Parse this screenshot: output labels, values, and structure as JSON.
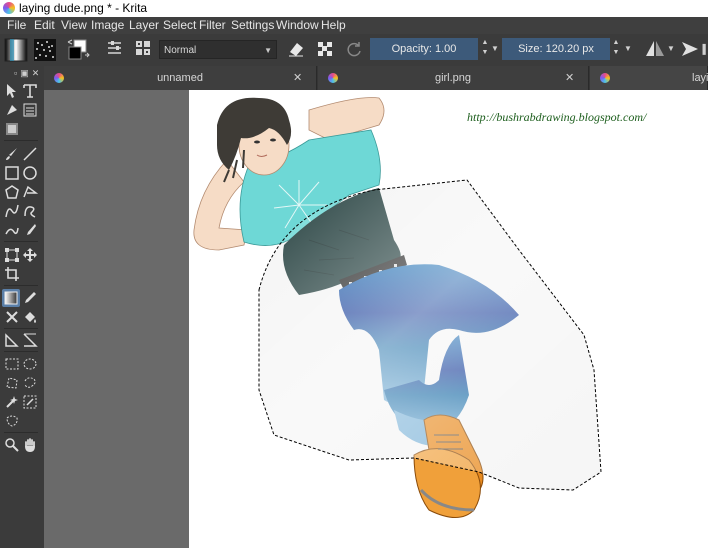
{
  "window": {
    "title": "laying dude.png * - Krita"
  },
  "menu": [
    "File",
    "Edit",
    "View",
    "Image",
    "Layer",
    "Select",
    "Filter",
    "Settings",
    "Window",
    "Help"
  ],
  "toolbar": {
    "blend_mode": "Normal",
    "opacity_label": "Opacity:  1.00",
    "size_label": "Size:  120.20 px"
  },
  "tabs": [
    {
      "name": "unnamed"
    },
    {
      "name": "girl.png"
    },
    {
      "name": "layi"
    }
  ],
  "canvas": {
    "watermark": "http://bushrabdrawing.blogspot.com/"
  },
  "colors": {
    "accent": "#5a7fa8",
    "slider": "#3d5a7a",
    "canvas": "#ffffff",
    "workspace": "#6a6a6a"
  },
  "icons": [
    "krita-logo-icon",
    "gradient-preset-icon",
    "brush-preset-icon",
    "swap-colors-icon",
    "brush-settings-icon",
    "pattern-icon",
    "eraser-icon",
    "preserve-alpha-icon",
    "reload-icon",
    "mirror-horizontal-icon",
    "wrap-icon",
    "close-icon",
    "pin-icon"
  ]
}
